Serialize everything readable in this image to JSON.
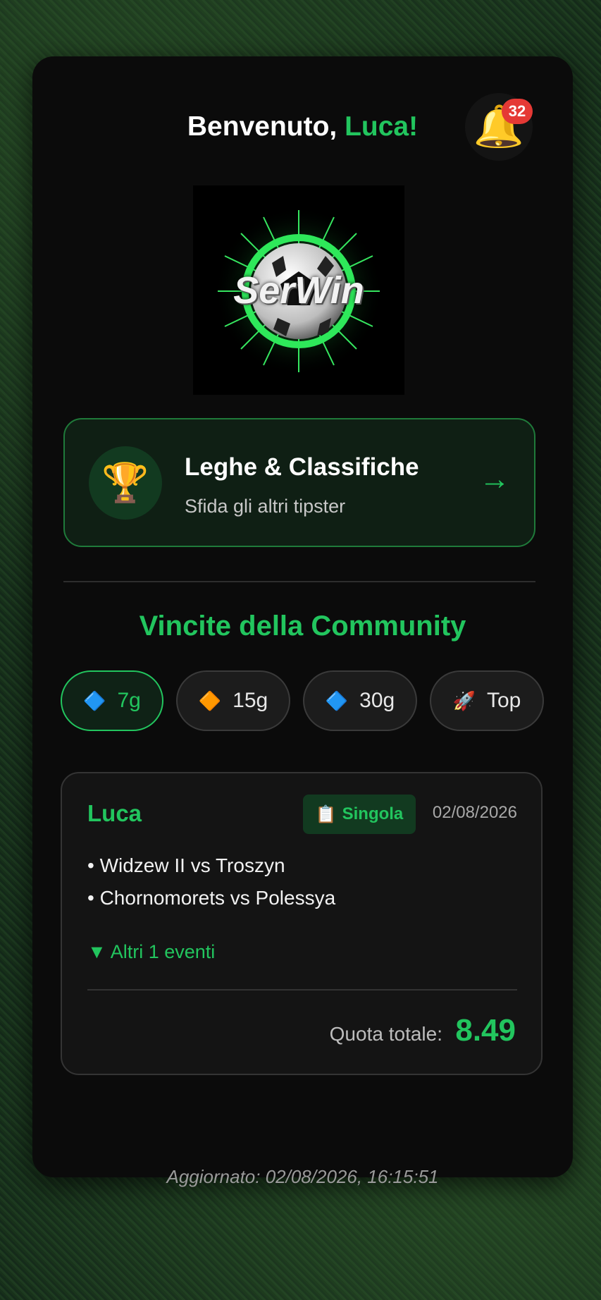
{
  "header": {
    "welcome_prefix": "Benvenuto, ",
    "user_name": "Luca!",
    "notifications_count": "32"
  },
  "logo": {
    "text": "SerWin"
  },
  "leagues_card": {
    "title": "Leghe & Classifiche",
    "subtitle": "Sfida gli altri tipster",
    "icon": "trophy-icon",
    "arrow": "→"
  },
  "community": {
    "title": "Vincite della Community",
    "filters": [
      {
        "icon": "🔷",
        "label": "7g",
        "active": true
      },
      {
        "icon": "🔶",
        "label": "15g",
        "active": false
      },
      {
        "icon": "🔷",
        "label": "30g",
        "active": false
      },
      {
        "icon": "🚀",
        "label": "Top",
        "active": false
      }
    ]
  },
  "post": {
    "user": "Luca",
    "type_icon": "📋",
    "type": "Singola",
    "date": "02/08/2026",
    "events": [
      "• Widzew II vs Troszyn",
      "• Chornomorets vs Polessya"
    ],
    "more": "▼ Altri 1 eventi",
    "odds_label": "Quota totale:",
    "odds_value": "8.49"
  },
  "footer": {
    "updated": "Aggiornato: 02/08/2026, 16:15:51"
  },
  "colors": {
    "accent": "#22c55e",
    "card_bg": "#0b0b0b",
    "badge": "#e53935"
  }
}
